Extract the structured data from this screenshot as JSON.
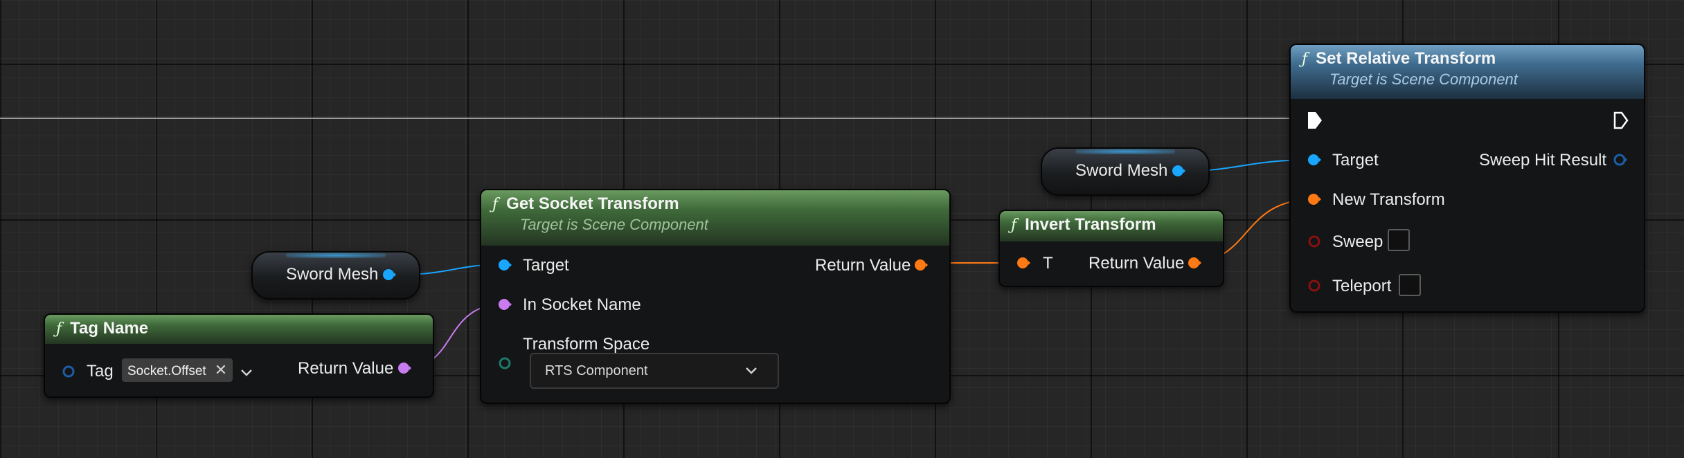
{
  "colors": {
    "object_pin": "#19a6ff",
    "transform_pin": "#ff7a14",
    "name_pin": "#c97cf0",
    "struct_pin": "#1d5ea8",
    "enum_pin": "#1d7a6a",
    "bool_pin": "#8a1010",
    "exec_pin": "#ffffff",
    "header_green": "#4e7e46",
    "header_blue": "#4f7fa4"
  },
  "icons": {
    "function": "function-icon",
    "exec": "exec-pin-icon"
  },
  "function_glyph": "ƒ",
  "nodes": {
    "tag_name": {
      "title": "Tag Name",
      "tag_label": "Tag",
      "tag_value": "Socket.Offset",
      "clear_glyph": "✕",
      "return_label": "Return Value"
    },
    "get_socket_transform": {
      "title": "Get Socket Transform",
      "subtitle": "Target is Scene Component",
      "target_label": "Target",
      "socket_name_label": "In Socket Name",
      "transform_space_label": "Transform Space",
      "transform_space_value": "RTS Component",
      "return_label": "Return Value"
    },
    "invert_transform": {
      "title": "Invert Transform",
      "input_label": "T",
      "return_label": "Return Value"
    },
    "set_relative_transform": {
      "title": "Set Relative Transform",
      "subtitle": "Target is Scene Component",
      "target_label": "Target",
      "new_transform_label": "New Transform",
      "sweep_label": "Sweep",
      "teleport_label": "Teleport",
      "sweep_hit_label": "Sweep Hit Result",
      "sweep_checked": false,
      "teleport_checked": false
    }
  },
  "variables": {
    "sword_mesh_1": "Sword Mesh",
    "sword_mesh_2": "Sword Mesh"
  }
}
